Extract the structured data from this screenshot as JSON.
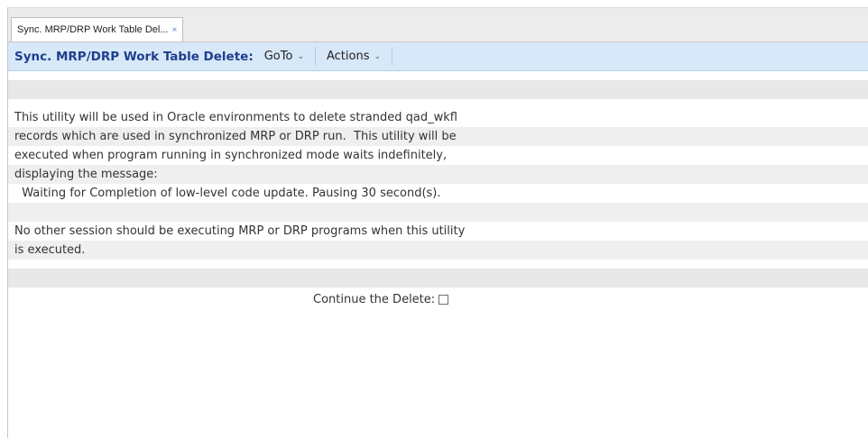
{
  "tab": {
    "label": "Sync. MRP/DRP Work Table Del...",
    "close": "×"
  },
  "toolbar": {
    "title": "Sync. MRP/DRP Work Table Delete:",
    "menus": [
      {
        "label": "GoTo"
      },
      {
        "label": "Actions"
      }
    ]
  },
  "body": {
    "lines": [
      "This utility will be used in Oracle environments to delete stranded qad_wkfl",
      "records which are used in synchronized MRP or DRP run.  This utility will be",
      "executed when program running in synchronized mode waits indefinitely,",
      "displaying the message:",
      "  Waiting for Completion of low-level code update. Pausing 30 second(s).",
      "",
      "No other session should be executing MRP or DRP programs when this utility",
      "is executed."
    ]
  },
  "form": {
    "continue_label": "Continue the Delete:",
    "continue_checked": false
  }
}
